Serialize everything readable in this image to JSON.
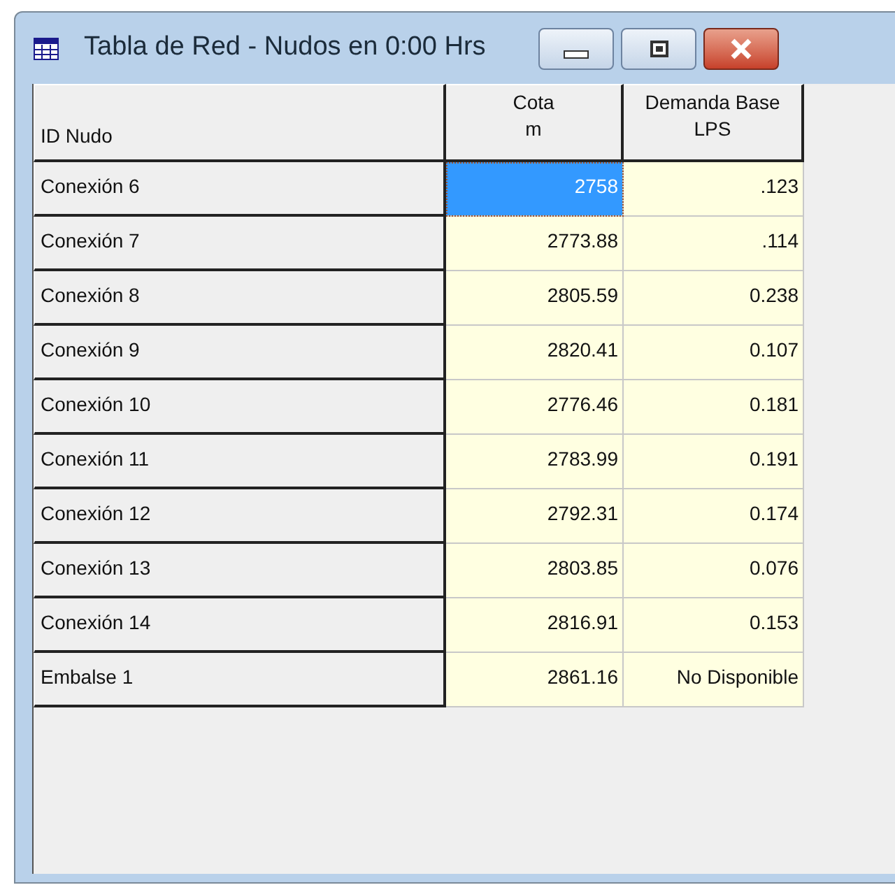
{
  "window": {
    "title": "Tabla de Red - Nudos en 0:00 Hrs"
  },
  "table": {
    "columns": [
      {
        "label": "ID Nudo"
      },
      {
        "label": "Cota",
        "unit": "m"
      },
      {
        "label": "Demanda Base",
        "unit": "LPS"
      }
    ],
    "rows": [
      {
        "id": "Conexión 6",
        "cota": "2758",
        "demanda": ".123",
        "selected": true
      },
      {
        "id": "Conexión 7",
        "cota": "2773.88",
        "demanda": ".114",
        "selected": false
      },
      {
        "id": "Conexión 8",
        "cota": "2805.59",
        "demanda": "0.238",
        "selected": false
      },
      {
        "id": "Conexión 9",
        "cota": "2820.41",
        "demanda": "0.107",
        "selected": false
      },
      {
        "id": "Conexión 10",
        "cota": "2776.46",
        "demanda": "0.181",
        "selected": false
      },
      {
        "id": "Conexión 11",
        "cota": "2783.99",
        "demanda": "0.191",
        "selected": false
      },
      {
        "id": "Conexión 12",
        "cota": "2792.31",
        "demanda": "0.174",
        "selected": false
      },
      {
        "id": "Conexión 13",
        "cota": "2803.85",
        "demanda": "0.076",
        "selected": false
      },
      {
        "id": "Conexión 14",
        "cota": "2816.91",
        "demanda": "0.153",
        "selected": false
      },
      {
        "id": "Embalse 1",
        "cota": "2861.16",
        "demanda": "No Disponible",
        "selected": false
      }
    ]
  }
}
